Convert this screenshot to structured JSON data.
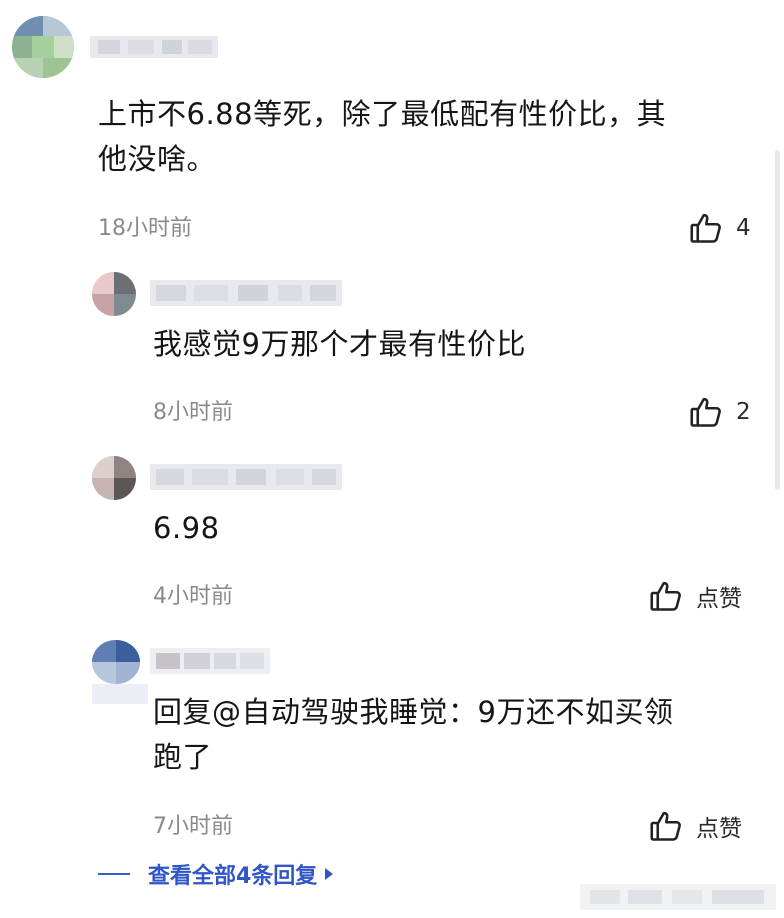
{
  "comments": [
    {
      "text_line1": "上市不6.88等死，除了最低配有性价比，其",
      "text_line2": "他没啥。",
      "time": "18小时前",
      "likes": "4"
    }
  ],
  "replies": [
    {
      "text": "我感觉9万那个才最有性价比",
      "time": "8小时前",
      "likes": "2"
    },
    {
      "text": "6.98",
      "time": "4小时前",
      "likes": "点赞"
    },
    {
      "text_line1": "回复@自动驾驶我睡觉：9万还不如买领",
      "text_line2": "跑了",
      "time": "7小时前",
      "likes": "点赞"
    }
  ],
  "view_all": {
    "label": "查看全部4条回复"
  },
  "icons": {
    "like": "thumbs-up-icon",
    "caret": "caret-right-icon"
  },
  "colors": {
    "link": "#2f55c8",
    "timestamp": "#8a8a8a",
    "text": "#161616"
  }
}
